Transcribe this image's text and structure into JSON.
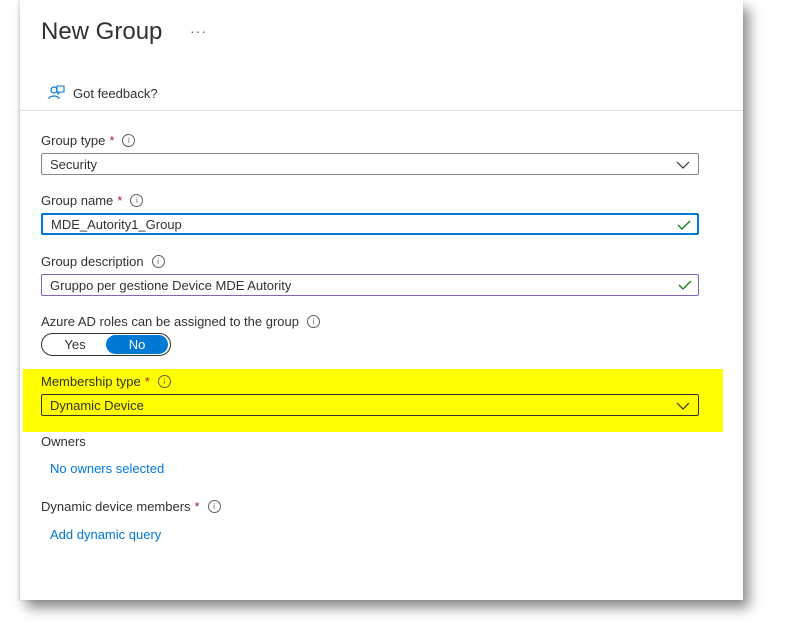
{
  "header": {
    "title": "New Group",
    "more": "···"
  },
  "feedback": {
    "label": "Got feedback?"
  },
  "group_type": {
    "label": "Group type",
    "required": "*",
    "value": "Security"
  },
  "group_name": {
    "label": "Group name",
    "required": "*",
    "value": "MDE_Autority1_Group"
  },
  "group_description": {
    "label": "Group description",
    "value": "Gruppo per gestione Device MDE Autority"
  },
  "azure_roles": {
    "label": "Azure AD roles can be assigned to the group",
    "yes": "Yes",
    "no": "No",
    "selected": "No"
  },
  "membership_type": {
    "label": "Membership type",
    "required": "*",
    "value": "Dynamic Device"
  },
  "owners": {
    "label": "Owners",
    "link": "No owners selected"
  },
  "dynamic_members": {
    "label": "Dynamic device members",
    "required": "*",
    "link": "Add dynamic query"
  },
  "info_icon": "i",
  "colors": {
    "accent": "#0078d4",
    "required": "#a4262c",
    "highlight": "#ffff00",
    "valid": "#107c10"
  }
}
